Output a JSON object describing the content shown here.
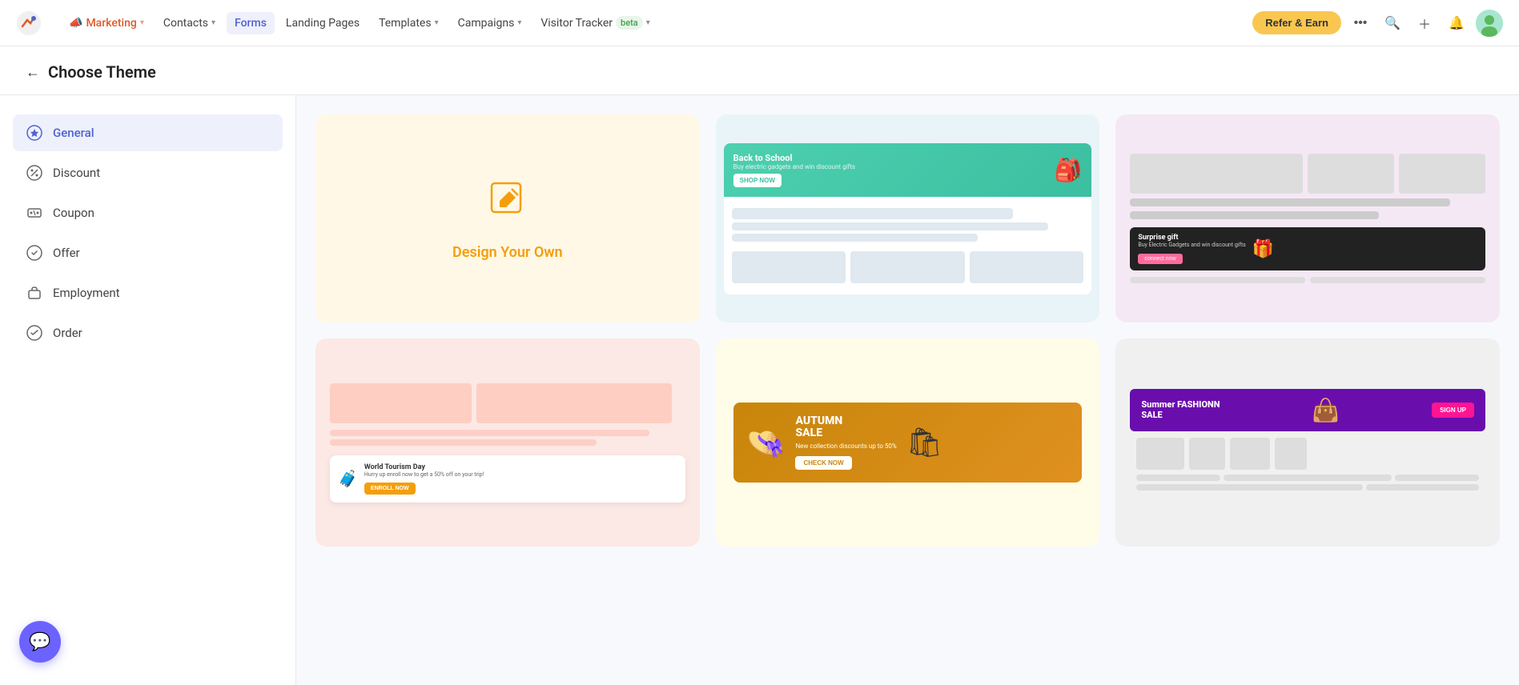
{
  "app": {
    "logo_icon": "🚀",
    "title": "Visitor Tracker beta"
  },
  "nav": {
    "marketing_label": "Marketing",
    "contacts_label": "Contacts",
    "forms_label": "Forms",
    "landing_pages_label": "Landing Pages",
    "templates_label": "Templates",
    "campaigns_label": "Campaigns",
    "visitor_tracker_label": "Visitor Tracker",
    "beta_label": "beta",
    "refer_earn_label": "Refer & Earn",
    "more_label": "..."
  },
  "page": {
    "back_label": "←",
    "title": "Choose Theme"
  },
  "sidebar": {
    "items": [
      {
        "id": "general",
        "label": "General",
        "active": true
      },
      {
        "id": "discount",
        "label": "Discount",
        "active": false
      },
      {
        "id": "coupon",
        "label": "Coupon",
        "active": false
      },
      {
        "id": "offer",
        "label": "Offer",
        "active": false
      },
      {
        "id": "employment",
        "label": "Employment",
        "active": false
      },
      {
        "id": "order",
        "label": "Order",
        "active": false
      }
    ]
  },
  "templates": {
    "design_own_label": "Design Your Own",
    "cards": [
      {
        "id": "design-own",
        "type": "design-own"
      },
      {
        "id": "back-to-school",
        "type": "back-to-school",
        "title": "Back to School"
      },
      {
        "id": "surprise-gift",
        "type": "surprise-gift",
        "title": "Surprise gift",
        "subtitle": "Buy Electric Gadgets and win discount gifts"
      },
      {
        "id": "tourism",
        "type": "tourism",
        "title": "World Tourism Day",
        "subtitle": "Hurry up enroll now to get a 50% off on your trip!"
      },
      {
        "id": "autumn-sale",
        "type": "autumn-sale",
        "title": "AUTUMN SALE",
        "subtitle": "New collection discounts up to 50%",
        "cta": "CHECK NOW"
      },
      {
        "id": "fashion",
        "type": "fashion",
        "title": "Summer FASHIONN SALE",
        "cta": "SIGN UP"
      }
    ]
  },
  "chat": {
    "icon": "💬"
  }
}
